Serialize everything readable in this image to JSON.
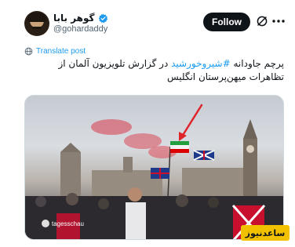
{
  "user": {
    "display_name": "گوهر بابا",
    "handle": "@gohardaddy",
    "verified": true
  },
  "header": {
    "follow_label": "Follow",
    "grok_icon": "grok-icon",
    "more_icon": "more-icon"
  },
  "translate": {
    "label": "Translate post",
    "icon": "globe-icon"
  },
  "tweet": {
    "line1_before": "پرچم جاودانه ",
    "line1_hashtag": "#شیروخورشید",
    "line1_after": " در گزارش تلویزیون آلمان از",
    "line2": "تظاهرات میهن‌پرستان انگلیس"
  },
  "media": {
    "watermark": "tagesschau"
  },
  "brand": {
    "label": "ساعدنیوز"
  },
  "colors": {
    "accent": "#1d9bf0",
    "follow_bg": "#0f1419",
    "brand_yellow": "#f2c200"
  }
}
